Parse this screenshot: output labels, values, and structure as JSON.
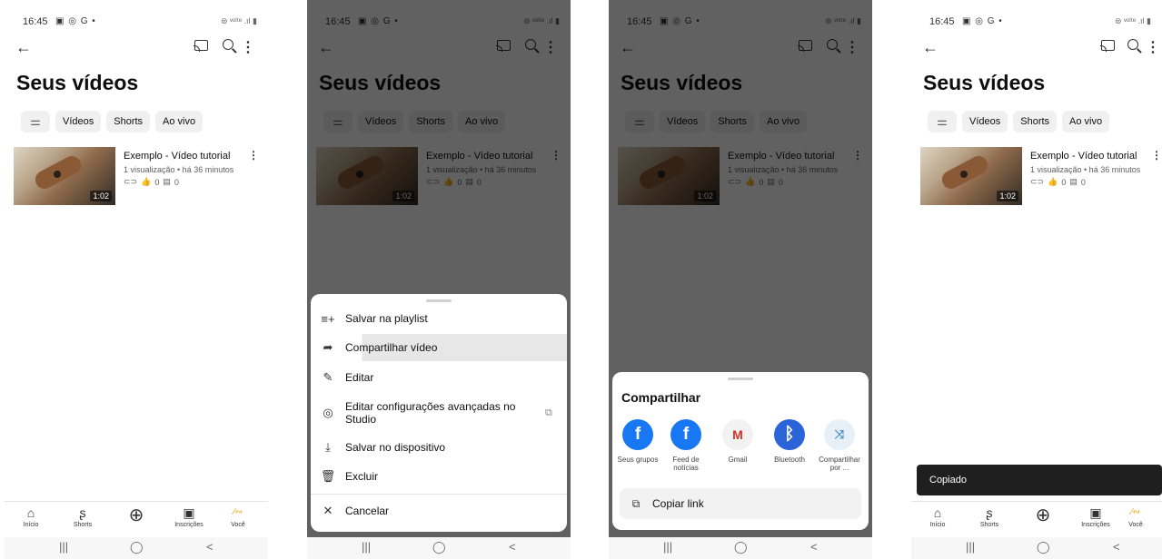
{
  "status": {
    "time": "16:45",
    "left_icons": "▣ ◎ G •",
    "right_icons": "⊜ ᵛᵒˡᵗᵉ .ıl ▮"
  },
  "topbar": {
    "back": "←",
    "more": "⋮"
  },
  "page": {
    "title": "Seus vídeos"
  },
  "chips": {
    "filter_icon": "⚌",
    "videos": "Vídeos",
    "shorts": "Shorts",
    "live": "Ao vivo"
  },
  "video": {
    "title": "Exemplo - Vídeo tutorial",
    "meta": "1 visualização • há 36 minutos",
    "link_icon": "⊂⊃",
    "likes": "0",
    "comments": "0",
    "duration": "1:02",
    "more": "⋮"
  },
  "bottom_nav": [
    {
      "icon": "⌂",
      "label": "Início"
    },
    {
      "icon": "ʂ",
      "label": "Shorts"
    },
    {
      "icon": "⊕",
      "label": ""
    },
    {
      "icon": "▣",
      "label": "Inscrições"
    },
    {
      "icon": "∕∾",
      "label": "Você"
    }
  ],
  "system_nav": {
    "recents": "|||",
    "home": "◯",
    "back": "<"
  },
  "menu": {
    "items": [
      {
        "icon": "≡+",
        "label": "Salvar na playlist"
      },
      {
        "icon": "➦",
        "label": "Compartilhar vídeo"
      },
      {
        "icon": "✎",
        "label": "Editar"
      },
      {
        "icon": "◎",
        "label": "Editar configurações avançadas no Studio",
        "ext": "⧉"
      },
      {
        "icon": "⤓",
        "label": "Salvar no dispositivo"
      },
      {
        "icon": "🗑",
        "label": "Excluir"
      }
    ],
    "cancel": {
      "icon": "✕",
      "label": "Cancelar"
    }
  },
  "share": {
    "title": "Compartilhar",
    "apps": [
      {
        "icon": "f",
        "label": "Seus grupos"
      },
      {
        "icon": "f",
        "label": "Feed de notícias"
      },
      {
        "icon": "M",
        "label": "Gmail"
      },
      {
        "icon": "ᛒ",
        "label": "Bluetooth"
      },
      {
        "icon": "⤨",
        "label": "Compartilhar por ..."
      }
    ],
    "copy_link": {
      "icon": "⧉",
      "label": "Copiar link"
    }
  },
  "toast": {
    "text": "Copiado"
  },
  "colors": {
    "facebook": "#1877f2",
    "bluetooth": "#2b64d8",
    "gmail_red": "#d93025",
    "toast_bg": "#1f1f1f"
  }
}
